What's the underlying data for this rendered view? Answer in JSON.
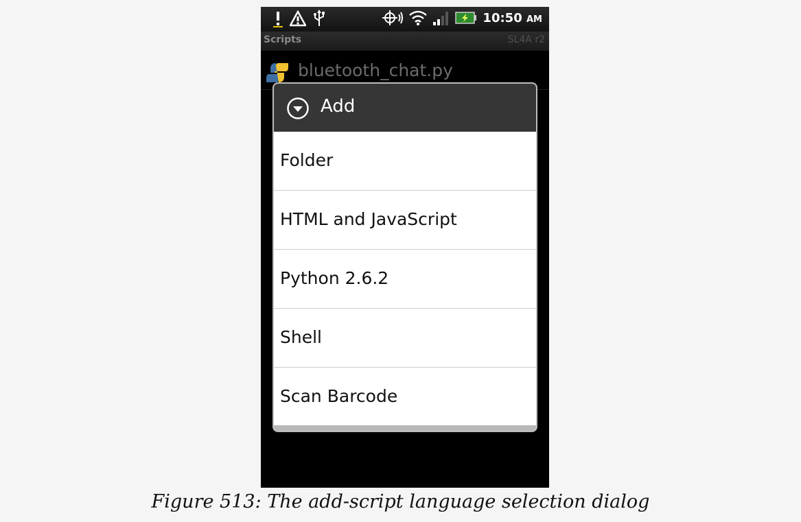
{
  "status_bar": {
    "time": "10:50",
    "ampm": "AM",
    "icons": [
      "alert-icon",
      "warning-icon",
      "usb-icon",
      "gps-icon",
      "wifi-icon",
      "signal-icon",
      "battery-icon"
    ]
  },
  "app": {
    "title": "Scripts",
    "version": "SL4A r2"
  },
  "scripts": [
    {
      "name": "bluetooth_chat.py"
    }
  ],
  "dialog": {
    "title": "Add",
    "options": [
      {
        "label": "Folder"
      },
      {
        "label": "HTML and JavaScript"
      },
      {
        "label": "Python 2.6.2"
      },
      {
        "label": "Shell"
      },
      {
        "label": "Scan Barcode"
      }
    ]
  },
  "caption": "Figure 513: The add-script language selection dialog",
  "colors": {
    "phone_background": "#000000",
    "dialog_header": "#363636",
    "dialog_body": "#ffffff",
    "python_blue": "#3d6fa3",
    "python_yellow": "#f2c230"
  }
}
